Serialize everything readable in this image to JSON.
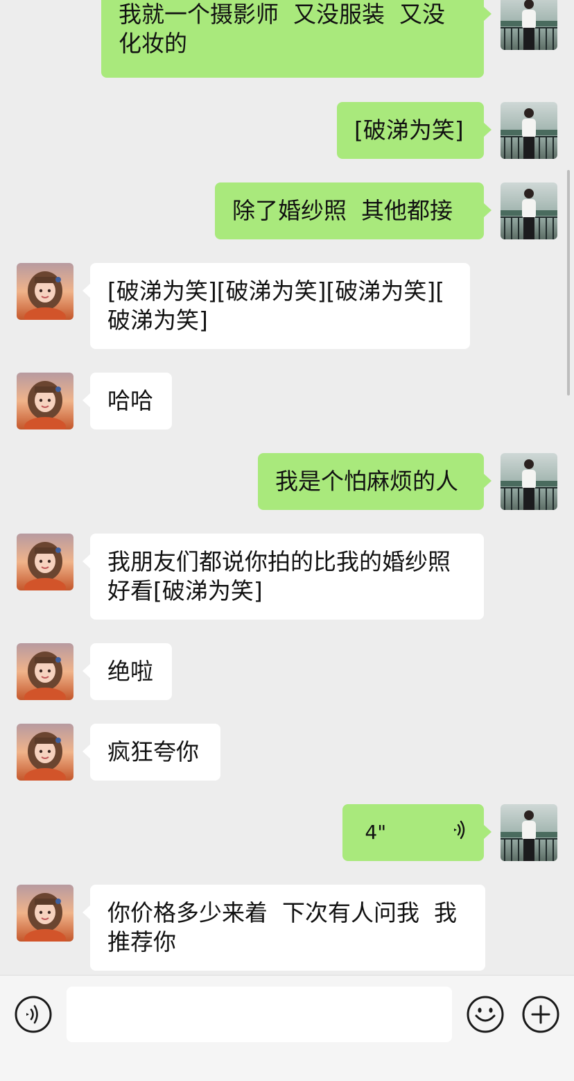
{
  "theme": {
    "background": "#ededed",
    "sent_bubble": "#a9e97c",
    "received_bubble": "#ffffff"
  },
  "messages": [
    {
      "side": "right",
      "kind": "text",
      "text": "我就一个摄影师  又没服装  又没\n化妆的"
    },
    {
      "side": "right",
      "kind": "text",
      "text": "[破涕为笑]"
    },
    {
      "side": "right",
      "kind": "text",
      "text": "除了婚纱照  其他都接"
    },
    {
      "side": "left",
      "kind": "text",
      "text": "[破涕为笑][破涕为笑][破涕为笑][\n破涕为笑]"
    },
    {
      "side": "left",
      "kind": "text",
      "text": "哈哈"
    },
    {
      "side": "right",
      "kind": "text",
      "text": "我是个怕麻烦的人"
    },
    {
      "side": "left",
      "kind": "text",
      "text": "我朋友们都说你拍的比我的婚纱照\n好看[破涕为笑]"
    },
    {
      "side": "left",
      "kind": "text",
      "text": "绝啦"
    },
    {
      "side": "left",
      "kind": "text",
      "text": "疯狂夸你"
    },
    {
      "side": "right",
      "kind": "voice",
      "text": "4\"",
      "icon": "voice-wave-icon"
    },
    {
      "side": "left",
      "kind": "text",
      "text": "你价格多少来着  下次有人问我  我\n推荐你"
    }
  ],
  "input_bar": {
    "voice_icon": "voice-mode-icon",
    "emoji_icon": "emoji-icon",
    "plus_icon": "plus-icon",
    "input_value": ""
  }
}
